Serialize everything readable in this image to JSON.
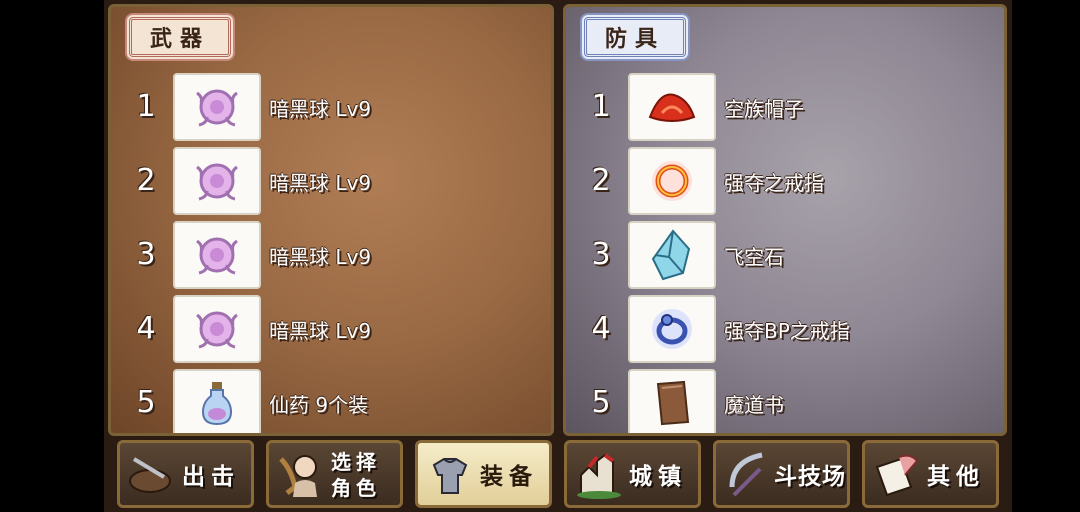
{
  "weapons": {
    "title": "武器",
    "slots": [
      {
        "num": "1",
        "name": "暗黑球 Lv9",
        "icon": "dark-orb-icon"
      },
      {
        "num": "2",
        "name": "暗黑球 Lv9",
        "icon": "dark-orb-icon"
      },
      {
        "num": "3",
        "name": "暗黑球 Lv9",
        "icon": "dark-orb-icon"
      },
      {
        "num": "4",
        "name": "暗黑球 Lv9",
        "icon": "dark-orb-icon"
      },
      {
        "num": "5",
        "name": "仙药 9个装",
        "icon": "potion-icon"
      }
    ]
  },
  "armor": {
    "title": "防具",
    "slots": [
      {
        "num": "1",
        "name": "空族帽子",
        "icon": "red-hat-icon"
      },
      {
        "num": "2",
        "name": "强夺之戒指",
        "icon": "gold-ring-icon"
      },
      {
        "num": "3",
        "name": "飞空石",
        "icon": "crystal-icon"
      },
      {
        "num": "4",
        "name": "强夺BP之戒指",
        "icon": "blue-ring-icon"
      },
      {
        "num": "5",
        "name": "魔道书",
        "icon": "book-icon"
      }
    ]
  },
  "nav": {
    "sortie": "出击",
    "select_line1": "选择",
    "select_line2": "角色",
    "equip": "装备",
    "town": "城镇",
    "arena": "斗技场",
    "other": "其他",
    "active": "equip"
  },
  "colors": {
    "weapon_panel": "#9a6a44",
    "armor_panel": "#8f8894",
    "frame_gold": "#8a6a38"
  }
}
